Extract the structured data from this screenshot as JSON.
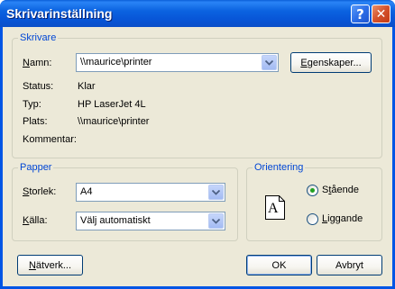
{
  "window": {
    "title": "Skrivarinställning",
    "help_label": "?",
    "close_label": "✕"
  },
  "printer_group": {
    "label": "Skrivare",
    "name_label_pre": "",
    "name_label_u": "N",
    "name_label_post": "amn:",
    "name_value": "\\\\maurice\\printer",
    "properties_pre": "",
    "properties_u": "E",
    "properties_post": "genskaper...",
    "status_label": "Status:",
    "status_value": "Klar",
    "type_label": "Typ:",
    "type_value": "HP LaserJet 4L",
    "location_label": "Plats:",
    "location_value": "\\\\maurice\\printer",
    "comment_label": "Kommentar:",
    "comment_value": ""
  },
  "paper_group": {
    "label": "Papper",
    "size_label_pre": "",
    "size_label_u": "S",
    "size_label_post": "torlek:",
    "size_value": "A4",
    "source_label_pre": "",
    "source_label_u": "K",
    "source_label_post": "älla:",
    "source_value": "Välj automatiskt"
  },
  "orientation_group": {
    "label": "Orientering",
    "preview_letter": "A",
    "portrait_pre": "S",
    "portrait_u": "t",
    "portrait_post": "ående",
    "portrait_selected": true,
    "landscape_pre": "",
    "landscape_u": "L",
    "landscape_post": "iggande",
    "landscape_selected": false
  },
  "buttons": {
    "network_pre": "",
    "network_u": "N",
    "network_post": "ätverk...",
    "ok_label": "OK",
    "cancel_label": "Avbryt"
  },
  "colors": {
    "titlebar": "#0055e5",
    "group_label": "#0046d5",
    "dialog_bg": "#ece9d8"
  }
}
